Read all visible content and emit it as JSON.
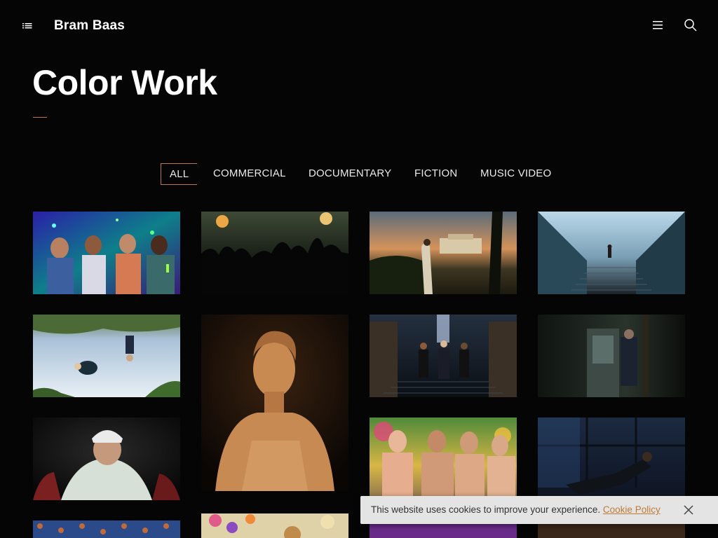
{
  "header": {
    "brand": "Bram Baas",
    "icons": {
      "left_menu": "list-menu-icon",
      "right_menu": "hamburger-icon",
      "search": "search-icon"
    }
  },
  "page": {
    "title": "Color Work",
    "accent_color": "#b77a4c"
  },
  "filters": [
    {
      "label": "ALL",
      "active": true
    },
    {
      "label": "COMMERCIAL",
      "active": false
    },
    {
      "label": "DOCUMENTARY",
      "active": false
    },
    {
      "label": "FICTION",
      "active": false
    },
    {
      "label": "MUSIC VIDEO",
      "active": false
    }
  ],
  "gallery": {
    "items": [
      {
        "id": "party-friends-neon"
      },
      {
        "id": "concert-crowd-flares"
      },
      {
        "id": "woman-palace-sunset"
      },
      {
        "id": "runner-stairs-glass"
      },
      {
        "id": "upside-down-jump"
      },
      {
        "id": "portrait-woman-warm"
      },
      {
        "id": "men-stairs-hall"
      },
      {
        "id": "man-dark-kitchen"
      },
      {
        "id": "man-cap-topdown"
      },
      {
        "id": "shirtless-men-tropical"
      },
      {
        "id": "fighter-night-window"
      },
      {
        "id": "pattern-carpet"
      },
      {
        "id": "flowers-bright"
      },
      {
        "id": "neon-purple"
      },
      {
        "id": "dark-interior"
      }
    ]
  },
  "cookie_bar": {
    "message": "This website uses cookies to improve your experience.",
    "link_label": "Cookie Policy",
    "link_color": "#c07a35",
    "close_icon": "close-icon"
  }
}
